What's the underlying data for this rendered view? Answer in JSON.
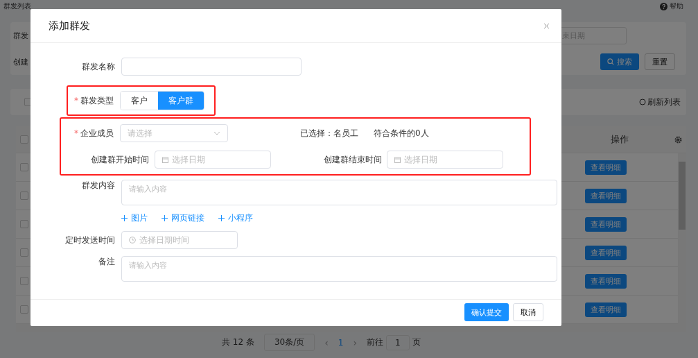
{
  "page": {
    "title": "群发列表",
    "help": "帮助"
  },
  "filters": {
    "row1_label": "群发",
    "end_date_placeholder": "束日期",
    "row2_label": "创建",
    "search": "搜索",
    "reset": "重置"
  },
  "toolbar": {
    "checked": false,
    "refresh": "刷新列表"
  },
  "table": {
    "header_checked": false,
    "action_header": "操作",
    "rows": [
      {
        "checked": false,
        "action": "查看明细"
      },
      {
        "checked": false,
        "action": "查看明细"
      },
      {
        "checked": false,
        "action": "查看明细"
      },
      {
        "checked": false,
        "action": "查看明细"
      },
      {
        "checked": false,
        "action": "查看明细"
      },
      {
        "checked": false,
        "action": "查看明细"
      }
    ]
  },
  "pagination": {
    "total": "共 12 条",
    "page_size": "30条/页",
    "prev": "‹",
    "next": "›",
    "pages": [
      {
        "label": "1",
        "selected": true
      }
    ],
    "goto_label": "前往",
    "goto_value": "1",
    "goto_suffix": "页"
  },
  "dialog": {
    "title": "添加群发",
    "required_mark": "*",
    "sections": [
      {
        "highlighted": false,
        "rows": [
          {
            "kind": "input",
            "label": "群发名称",
            "required": false
          }
        ]
      },
      {
        "highlighted": true,
        "rows": [
          {
            "kind": "segmented",
            "label": "群发类型",
            "required": true,
            "options": [
              {
                "label": "客户",
                "selected": false
              },
              {
                "label": "客户群",
                "selected": true
              }
            ]
          }
        ]
      },
      {
        "highlighted": true,
        "rows": [
          {
            "kind": "member",
            "label": "企业成员",
            "required": true,
            "placeholder": "请选择",
            "selected_text": "已选择：名员工",
            "match_text": "符合条件的0人"
          },
          {
            "kind": "date_range",
            "start_label": "创建群开始时间",
            "start_placeholder": "选择日期",
            "end_label": "创建群结束时间",
            "end_placeholder": "选择日期"
          }
        ]
      },
      {
        "highlighted": false,
        "rows": [
          {
            "kind": "textarea",
            "label": "群发内容",
            "required": false,
            "placeholder": "请输入内容"
          },
          {
            "kind": "links",
            "links": [
              "图片",
              "网页链接",
              "小程序"
            ]
          },
          {
            "kind": "datetime",
            "label": "定时发送时间",
            "required": false,
            "placeholder": "选择日期时间"
          },
          {
            "kind": "textarea",
            "label": "备注",
            "required": false,
            "placeholder": "请输入内容"
          }
        ]
      }
    ],
    "confirm": "确认提交",
    "cancel": "取消"
  }
}
